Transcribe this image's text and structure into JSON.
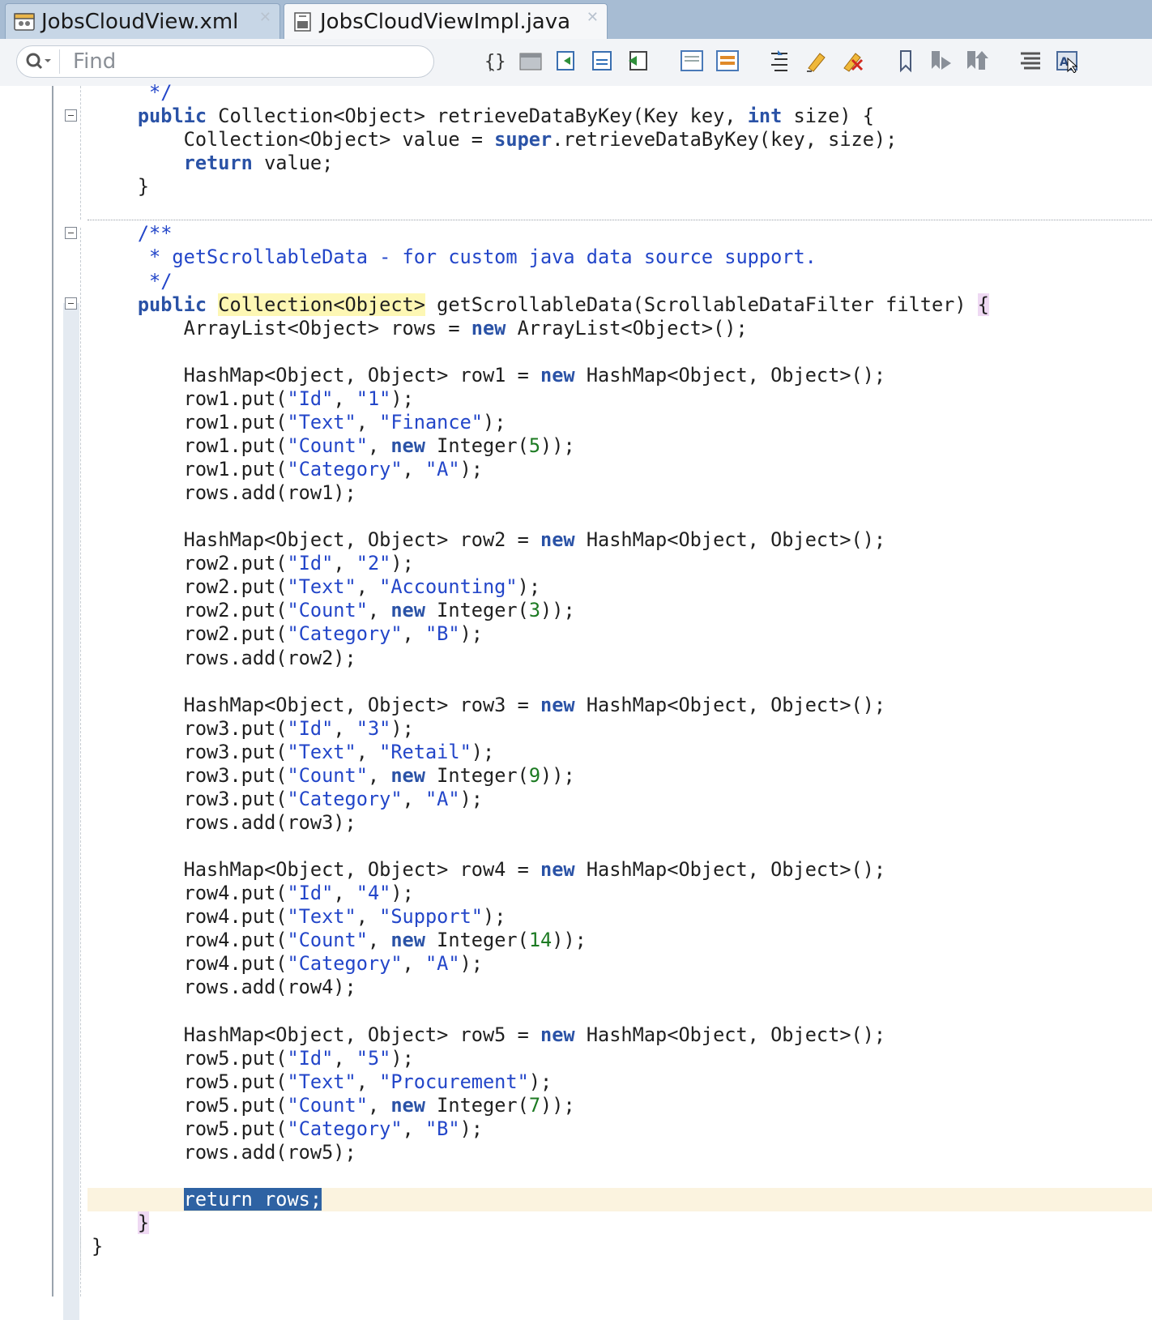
{
  "tabs": [
    {
      "label": "JobsCloudView.xml",
      "active": false,
      "icon": "xml-file-icon"
    },
    {
      "label": "JobsCloudViewImpl.java",
      "active": true,
      "icon": "java-file-icon"
    }
  ],
  "toolbar": {
    "find_placeholder": "Find",
    "icons": [
      "toggle-braces-icon",
      "code-template-icon",
      "navigate-back-icon",
      "navigate-forward-icon",
      "go-to-source-icon",
      "toggle-comment-icon",
      "toggle-block-icon",
      "format-code-icon",
      "highlight-icon",
      "clear-highlight-icon",
      "bookmark-icon",
      "next-bookmark-icon",
      "previous-bookmark-icon",
      "outline-icon",
      "code-assist-icon"
    ]
  },
  "editor": {
    "language": "java",
    "code_lines": [
      "     */",
      "    public Collection<Object> retrieveDataByKey(Key key, int size) {",
      "        Collection<Object> value = super.retrieveDataByKey(key, size);",
      "        return value;",
      "    }",
      "",
      "    /**",
      "     * getScrollableData - for custom java data source support.",
      "     */",
      "    public Collection<Object> getScrollableData(ScrollableDataFilter filter) {",
      "        ArrayList<Object> rows = new ArrayList<Object>();",
      "",
      "        HashMap<Object, Object> row1 = new HashMap<Object, Object>();",
      "        row1.put(\"Id\", \"1\");",
      "        row1.put(\"Text\", \"Finance\");",
      "        row1.put(\"Count\", new Integer(5));",
      "        row1.put(\"Category\", \"A\");",
      "        rows.add(row1);",
      "",
      "        HashMap<Object, Object> row2 = new HashMap<Object, Object>();",
      "        row2.put(\"Id\", \"2\");",
      "        row2.put(\"Text\", \"Accounting\");",
      "        row2.put(\"Count\", new Integer(3));",
      "        row2.put(\"Category\", \"B\");",
      "        rows.add(row2);",
      "",
      "        HashMap<Object, Object> row3 = new HashMap<Object, Object>();",
      "        row3.put(\"Id\", \"3\");",
      "        row3.put(\"Text\", \"Retail\");",
      "        row3.put(\"Count\", new Integer(9));",
      "        row3.put(\"Category\", \"A\");",
      "        rows.add(row3);",
      "",
      "        HashMap<Object, Object> row4 = new HashMap<Object, Object>();",
      "        row4.put(\"Id\", \"4\");",
      "        row4.put(\"Text\", \"Support\");",
      "        row4.put(\"Count\", new Integer(14));",
      "        row4.put(\"Category\", \"A\");",
      "        rows.add(row4);",
      "",
      "        HashMap<Object, Object> row5 = new HashMap<Object, Object>();",
      "        row5.put(\"Id\", \"5\");",
      "        row5.put(\"Text\", \"Procurement\");",
      "        row5.put(\"Count\", new Integer(7));",
      "        row5.put(\"Category\", \"B\");",
      "        rows.add(row5);",
      "",
      "        return rows;",
      "    }",
      "}"
    ],
    "selected_text": "return rows;",
    "matched_type_highlight": "Collection<Object>"
  },
  "colors": {
    "keyword": "#2a52a6",
    "string": "#2346c9",
    "number": "#1c7a22",
    "comment": "#2346c9",
    "selection": "#2e62a3",
    "occurrence_highlight": "#fdf7b4",
    "brace_match": "#efd9f3",
    "current_line": "#fbf3df",
    "tab_bar": "#a7bcd3"
  }
}
